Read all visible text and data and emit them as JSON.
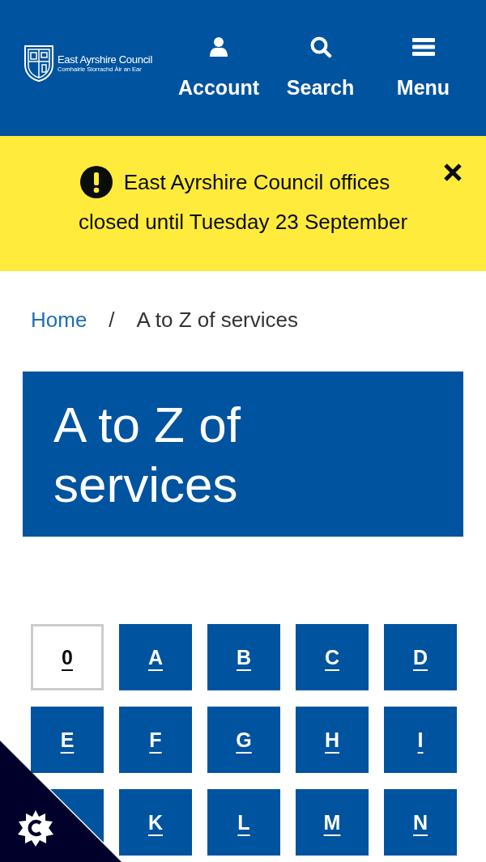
{
  "header": {
    "logo": {
      "name": "East Ayrshire Council",
      "subtitle": "Comhairle Siorrachd Àir an Ear"
    },
    "nav": [
      {
        "kind": "account",
        "label": "Account"
      },
      {
        "kind": "search",
        "label": "Search"
      },
      {
        "kind": "menu",
        "label": "Menu"
      }
    ]
  },
  "alert": {
    "lines": [
      "East Ayrshire Council offices",
      "closed until Tuesday 23 September"
    ]
  },
  "breadcrumb": [
    {
      "label": "Home",
      "kind": "link"
    },
    {
      "label": "/",
      "kind": "separator"
    },
    {
      "label": "A to Z of services",
      "kind": "current"
    }
  ],
  "title": "A to Z of services",
  "letters": [
    {
      "kind": "letter",
      "label": "0",
      "disabled": true
    },
    {
      "kind": "letter",
      "label": "A",
      "disabled": false
    },
    {
      "kind": "letter",
      "label": "B",
      "disabled": false
    },
    {
      "kind": "letter",
      "label": "C",
      "disabled": false
    },
    {
      "kind": "letter",
      "label": "D",
      "disabled": false
    },
    {
      "kind": "letter",
      "label": "E",
      "disabled": false
    },
    {
      "kind": "letter",
      "label": "F",
      "disabled": false
    },
    {
      "kind": "letter",
      "label": "G",
      "disabled": false
    },
    {
      "kind": "letter",
      "label": "H",
      "disabled": false
    },
    {
      "kind": "letter",
      "label": "I",
      "disabled": false
    },
    {
      "kind": "covered"
    },
    {
      "kind": "letter",
      "label": "K",
      "disabled": false
    },
    {
      "kind": "letter",
      "label": "L",
      "disabled": false
    },
    {
      "kind": "letter",
      "label": "M",
      "disabled": false
    },
    {
      "kind": "letter",
      "label": "N",
      "disabled": false
    }
  ]
}
